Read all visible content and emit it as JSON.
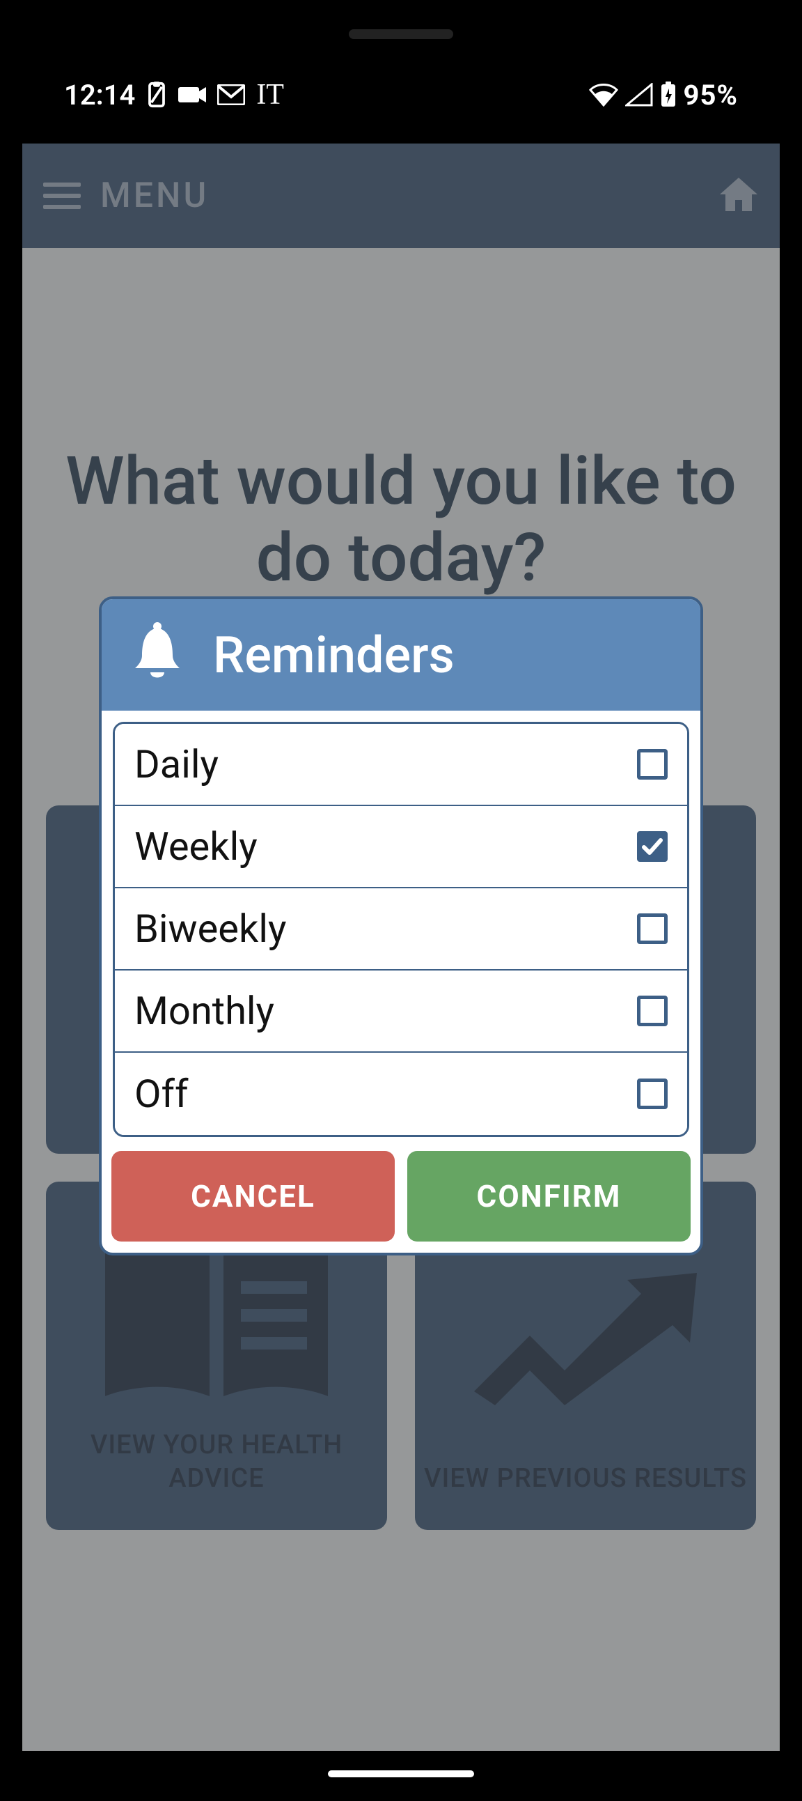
{
  "statusbar": {
    "time": "12:14",
    "icons_left": [
      "clipboard-icon",
      "camera-icon",
      "gmail-icon",
      "it-text-icon"
    ],
    "it_label": "IT",
    "battery_text": "95%"
  },
  "header": {
    "menu_label": "MENU"
  },
  "main": {
    "heading": "What would you like to do today?"
  },
  "tiles": [
    {
      "icon": "question-icon",
      "label": ""
    },
    {
      "icon": "target-icon",
      "label": ""
    },
    {
      "icon": "book-icon",
      "label": "VIEW YOUR HEALTH ADVICE"
    },
    {
      "icon": "trend-up-icon",
      "label": "VIEW PREVIOUS RESULTS"
    }
  ],
  "dialog": {
    "title": "Reminders",
    "options": [
      {
        "label": "Daily",
        "checked": false
      },
      {
        "label": "Weekly",
        "checked": true
      },
      {
        "label": "Biweekly",
        "checked": false
      },
      {
        "label": "Monthly",
        "checked": false
      },
      {
        "label": "Off",
        "checked": false
      }
    ],
    "cancel_label": "CANCEL",
    "confirm_label": "CONFIRM"
  }
}
